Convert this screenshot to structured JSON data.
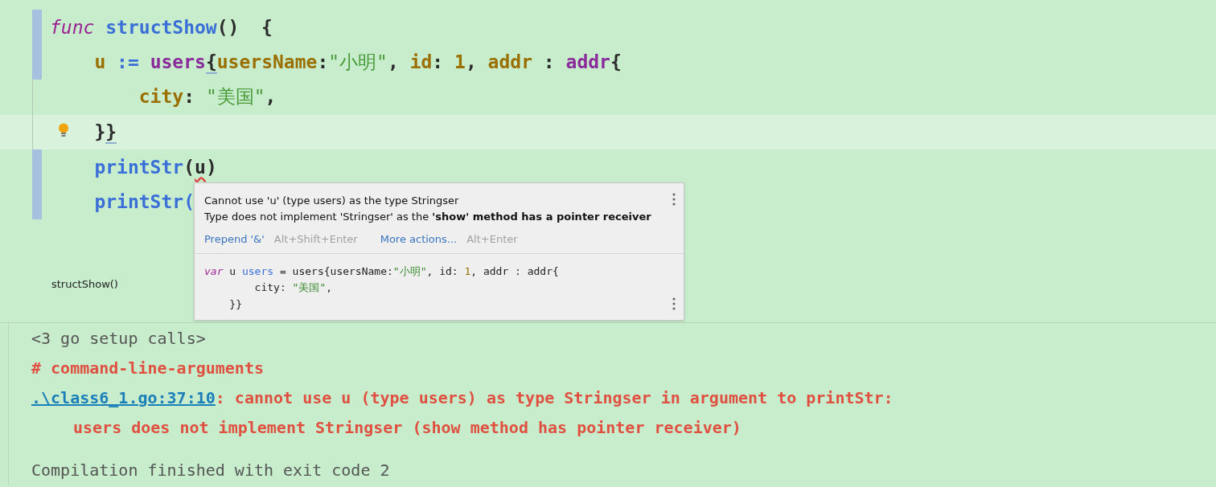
{
  "editor": {
    "lines": [
      {
        "changed": true,
        "current": false,
        "bulb": false,
        "tokens": [
          {
            "text": "func",
            "kind": "keyword"
          },
          {
            "text": " structShow",
            "kind": "func"
          },
          {
            "text": "()  {",
            "kind": "plain"
          }
        ]
      },
      {
        "changed": true,
        "current": false,
        "bulb": false,
        "tokens": [
          {
            "text": "    u",
            "kind": "var"
          },
          {
            "text": " := ",
            "kind": "op"
          },
          {
            "text": "users",
            "kind": "type"
          },
          {
            "text": "{",
            "kind": "match"
          },
          {
            "text": "usersName",
            "kind": "field"
          },
          {
            "text": ":",
            "kind": "plain"
          },
          {
            "text": "\"小明\"",
            "kind": "string"
          },
          {
            "text": ", ",
            "kind": "plain"
          },
          {
            "text": "id",
            "kind": "field"
          },
          {
            "text": ": ",
            "kind": "plain"
          },
          {
            "text": "1",
            "kind": "number"
          },
          {
            "text": ", ",
            "kind": "plain"
          },
          {
            "text": "addr",
            "kind": "field"
          },
          {
            "text": " : ",
            "kind": "plain"
          },
          {
            "text": "addr",
            "kind": "type"
          },
          {
            "text": "{",
            "kind": "plain"
          }
        ]
      },
      {
        "changed": false,
        "current": false,
        "bulb": false,
        "tokens": [
          {
            "text": "        city",
            "kind": "field"
          },
          {
            "text": ": ",
            "kind": "plain"
          },
          {
            "text": "\"美国\"",
            "kind": "string"
          },
          {
            "text": ",",
            "kind": "plain"
          }
        ]
      },
      {
        "changed": false,
        "current": true,
        "bulb": true,
        "tokens": [
          {
            "text": "    }",
            "kind": "plain"
          },
          {
            "text": "}",
            "kind": "match"
          }
        ]
      },
      {
        "changed": true,
        "current": false,
        "bulb": false,
        "tokens": [
          {
            "text": "    printStr",
            "kind": "func"
          },
          {
            "text": "(",
            "kind": "plain"
          },
          {
            "text": "u",
            "kind": "error"
          },
          {
            "text": ")",
            "kind": "plain"
          }
        ]
      },
      {
        "changed": true,
        "current": false,
        "bulb": false,
        "tokens": [
          {
            "text": "    printStr(",
            "kind": "func"
          }
        ]
      }
    ]
  },
  "breadcrumb": "structShow()",
  "popup": {
    "messages": [
      "Cannot use 'u' (type users) as the type Stringser",
      "Type does not implement 'Stringser' as the **'show' method has a pointer receiver**"
    ],
    "actions": [
      {
        "label": "Prepend '&'",
        "shortcut": "Alt+Shift+Enter"
      },
      {
        "label": "More actions...",
        "shortcut": "Alt+Enter"
      }
    ],
    "preview": [
      [
        {
          "text": "var",
          "kind": "keyword"
        },
        {
          "text": " u ",
          "kind": "plain"
        },
        {
          "text": "users",
          "kind": "typeref"
        },
        {
          "text": " = users{usersName:",
          "kind": "plain"
        },
        {
          "text": "\"小明\"",
          "kind": "string"
        },
        {
          "text": ", id: ",
          "kind": "plain"
        },
        {
          "text": "1",
          "kind": "number"
        },
        {
          "text": ", addr : addr{",
          "kind": "plain"
        }
      ],
      [
        {
          "text": "        city: ",
          "kind": "plain"
        },
        {
          "text": "\"美国\"",
          "kind": "string"
        },
        {
          "text": ",",
          "kind": "plain"
        }
      ],
      [
        {
          "text": "    }}",
          "kind": "plain"
        }
      ]
    ]
  },
  "console": {
    "lines": [
      {
        "kind": "info",
        "text": "<3 go setup calls>"
      },
      {
        "kind": "error",
        "text": "# command-line-arguments"
      },
      {
        "kind": "location",
        "link": ".\\class6_1.go:37:10",
        "text": ": cannot use u (type users) as type Stringser in argument to printStr:"
      },
      {
        "kind": "detail",
        "text": "users does not implement Stringser (show method has pointer receiver)"
      },
      {
        "kind": "blank"
      },
      {
        "kind": "info",
        "text": "Compilation finished with exit code 2"
      }
    ]
  }
}
